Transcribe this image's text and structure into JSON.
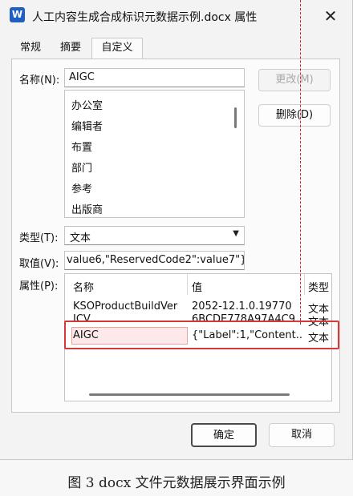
{
  "window": {
    "title": "人工内容生成合成标识元数据示例.docx 属性",
    "app_icon": "W",
    "close_glyph": "✕"
  },
  "tabs": [
    {
      "label": "常规"
    },
    {
      "label": "摘要"
    },
    {
      "label": "自定义",
      "active": true
    }
  ],
  "form": {
    "name_label": "名称(N):",
    "name_value": "AIGC",
    "modify_button": "更改(M)",
    "delete_button": "删除(D)",
    "name_options": [
      "办公室",
      "编辑者",
      "布置",
      "部门",
      "参考",
      "出版商"
    ],
    "type_label": "类型(T):",
    "type_value": "文本",
    "value_label": "取值(V):",
    "value_value": "value6,\"ReservedCode2\":value7\"}",
    "properties_label": "属性(P):"
  },
  "properties": {
    "columns": [
      "名称",
      "值",
      "类型"
    ],
    "rows": [
      {
        "name": "KSOProductBuildVer",
        "value": "2052-12.1.0.19770",
        "type": "文本"
      },
      {
        "name": "ICV",
        "value": "6BCDE778A97A4C9...",
        "type": "文本"
      },
      {
        "name": "AIGC",
        "value": "{\"Label\":1,\"Content...",
        "type": "文本",
        "selected": true
      }
    ]
  },
  "footer": {
    "ok_button": "确定",
    "cancel_button": "取消"
  },
  "caption": "图 3 docx 文件元数据展示界面示例",
  "colors": {
    "highlight": "#d43a3a",
    "accent": "#1f5fbf"
  }
}
